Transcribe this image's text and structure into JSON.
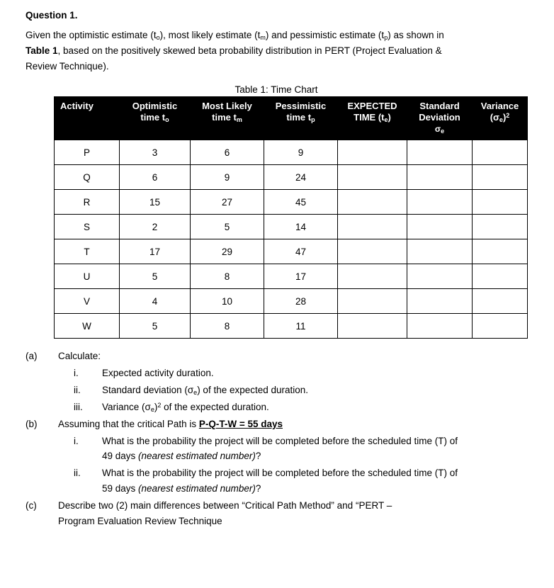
{
  "question": {
    "title": "Question 1.",
    "intro_1": "Given the optimistic estimate (t",
    "intro_sub_o": "o",
    "intro_2": "), most likely estimate (t",
    "intro_sub_m": "m",
    "intro_3": ") and pessimistic estimate (t",
    "intro_sub_p": "p",
    "intro_4": ") as shown in",
    "intro_line2_bold": "Table 1",
    "intro_line2_rest": ", based on the positively skewed beta probability distribution in PERT (Project Evaluation &",
    "intro_line3": "Review Technique)."
  },
  "table": {
    "caption": "Table 1: Time Chart",
    "headers": [
      {
        "line1": "Activity",
        "line2": "",
        "line3": ""
      },
      {
        "line1": "Optimistic",
        "line2": "time to",
        "line3": ""
      },
      {
        "line1": "Most Likely",
        "line2": "time tm",
        "line3": ""
      },
      {
        "line1": "Pessimistic",
        "line2": "time tp",
        "line3": ""
      },
      {
        "line1": "EXPECTED",
        "line2": "TIME (te)",
        "line3": ""
      },
      {
        "line1": "Standard",
        "line2": "Deviation",
        "line3": "σe"
      },
      {
        "line1": "Variance",
        "line2": "(σe)2",
        "line3": ""
      }
    ],
    "rows": [
      {
        "activity": "P",
        "optimistic": "3",
        "most_likely": "6",
        "pessimistic": "9",
        "expected": "",
        "std_dev": "",
        "variance": ""
      },
      {
        "activity": "Q",
        "optimistic": "6",
        "most_likely": "9",
        "pessimistic": "24",
        "expected": "",
        "std_dev": "",
        "variance": ""
      },
      {
        "activity": "R",
        "optimistic": "15",
        "most_likely": "27",
        "pessimistic": "45",
        "expected": "",
        "std_dev": "",
        "variance": ""
      },
      {
        "activity": "S",
        "optimistic": "2",
        "most_likely": "5",
        "pessimistic": "14",
        "expected": "",
        "std_dev": "",
        "variance": ""
      },
      {
        "activity": "T",
        "optimistic": "17",
        "most_likely": "29",
        "pessimistic": "47",
        "expected": "",
        "std_dev": "",
        "variance": ""
      },
      {
        "activity": "U",
        "optimistic": "5",
        "most_likely": "8",
        "pessimistic": "17",
        "expected": "",
        "std_dev": "",
        "variance": ""
      },
      {
        "activity": "V",
        "optimistic": "4",
        "most_likely": "10",
        "pessimistic": "28",
        "expected": "",
        "std_dev": "",
        "variance": ""
      },
      {
        "activity": "W",
        "optimistic": "5",
        "most_likely": "8",
        "pessimistic": "11",
        "expected": "",
        "std_dev": "",
        "variance": ""
      }
    ]
  },
  "parts": {
    "a_label": "(a)",
    "a_text": "Calculate:",
    "a_items": [
      {
        "num": "i.",
        "text": "Expected activity duration."
      },
      {
        "num": "ii.",
        "text_pre": "Standard deviation (σ",
        "sub": "e",
        "text_post": ") of the expected duration."
      },
      {
        "num": "iii.",
        "text_pre": "Variance (σ",
        "sub": "e",
        "text_post": ")2 of the expected duration."
      }
    ],
    "b_label": "(b)",
    "b_text_pre": "Assuming that the critical Path is ",
    "b_text_underline": "P-Q-T-W = 55 days",
    "b_items": [
      {
        "num": "i.",
        "line1": "What is the probability the project will be completed before the scheduled time (T) of",
        "line2_pre": "49 days ",
        "line2_italic": "(nearest estimated number)",
        "line2_post": "?"
      },
      {
        "num": "ii.",
        "line1": "What is the probability the project will be completed before the scheduled time (T) of",
        "line2_pre": "59 days ",
        "line2_italic": "(nearest estimated number)",
        "line2_post": "?"
      }
    ],
    "c_label": "(c)",
    "c_line1": "Describe two (2) main differences between “Critical Path Method” and “PERT –",
    "c_line2": "Program Evaluation Review Technique"
  }
}
